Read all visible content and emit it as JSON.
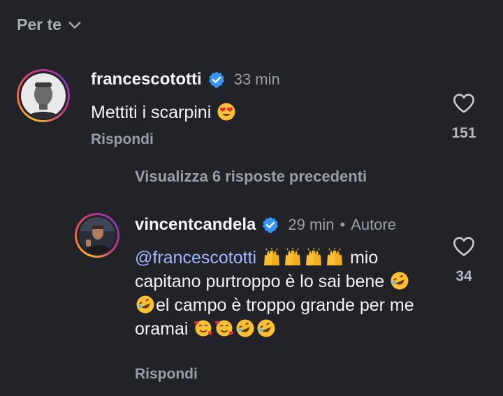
{
  "filter": {
    "label": "Per te"
  },
  "comments": [
    {
      "username": "francescototti",
      "time": "33 min",
      "text": "Mettiti i scarpini",
      "reply_label": "Rispondi",
      "likes": "151"
    },
    {
      "username": "vincentcandela",
      "time": "29 min",
      "separator": "•",
      "author_badge": "Autore",
      "mention": "@francescototti",
      "text_part1": "mio capitano purtroppo è lo sai bene",
      "text_part2": "el campo è troppo grande per me oramai",
      "reply_label": "Rispondi",
      "likes": "34"
    }
  ],
  "view_previous": "Visualizza 6 risposte precedenti",
  "colors": {
    "background": "#212328",
    "mention": "#a2b7ff",
    "verified": "#3797f0"
  }
}
